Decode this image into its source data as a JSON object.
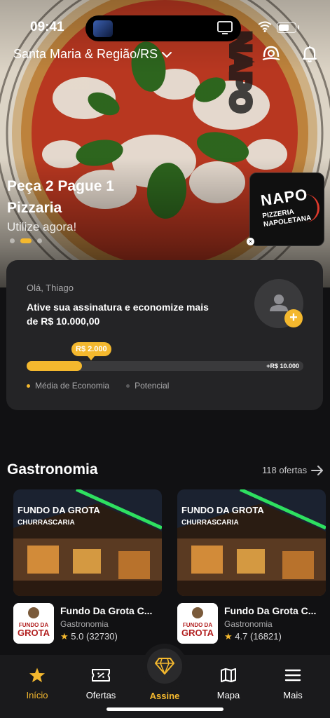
{
  "status_bar": {
    "time": "09:41"
  },
  "header": {
    "location": "Santa Maria & Região/RS"
  },
  "promo": {
    "title": "Peça 2 Pague 1 Pizzaria",
    "subtitle": "Utilize agora!",
    "brand_line1": "NAPO",
    "brand_line2": "PIZZERIA NAPOLETANA",
    "active_slide": 2,
    "slide_count": 3
  },
  "subscription": {
    "greeting": "Olá, Thiago",
    "headline": "Ative sua assinatura e economize mais de  R$ 10.000,00",
    "current_label": "R$ 2.000",
    "max_label": "+R$ 10.000",
    "progress_fraction": 0.2,
    "legend_average": "Média de Economia",
    "legend_potential": "Potencial"
  },
  "section": {
    "title": "Gastronomia",
    "link": "118 ofertas"
  },
  "offers": [
    {
      "name": "Fundo Da Grota C...",
      "category": "Gastronomia",
      "rating": "5.0",
      "reviews": "(32730)",
      "sign": "FUNDO DA GROTA",
      "sign2": "CHURRASCARIA",
      "logo1": "FUNDO DA",
      "logo2": "GROTA"
    },
    {
      "name": "Fundo Da Grota C...",
      "category": "Gastronomia",
      "rating": "4.7",
      "reviews": "(16821)",
      "sign": "FUNDO DA GROTA",
      "sign2": "CHURRASCARIA",
      "logo1": "FUNDO DA",
      "logo2": "GROTA"
    }
  ],
  "tabs": {
    "home": "Início",
    "offers": "Ofertas",
    "subscribe": "Assine",
    "map": "Mapa",
    "more": "Mais"
  },
  "colors": {
    "accent": "#f4b82e",
    "background": "#111113",
    "card": "#242426"
  },
  "icons": [
    "tv-icon",
    "wifi-icon",
    "battery-icon",
    "chevron-down-icon",
    "location-pin-icon",
    "bell-icon",
    "user-icon",
    "arrow-right-icon",
    "star-icon",
    "ticket-icon",
    "diamond-icon",
    "map-icon",
    "menu-icon"
  ]
}
